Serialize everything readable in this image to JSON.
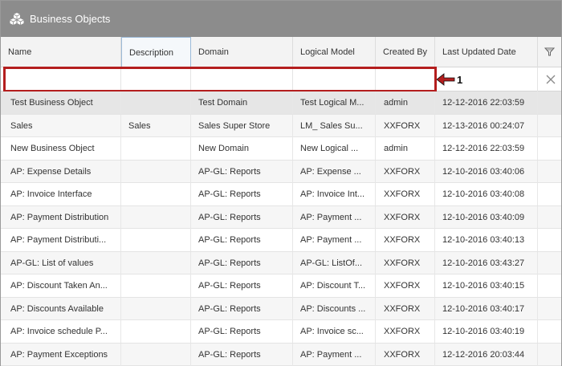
{
  "window": {
    "title": "Business Objects",
    "logo_icon": "business-objects-cubes-icon"
  },
  "table": {
    "columns": [
      {
        "key": "name",
        "label": "Name"
      },
      {
        "key": "description",
        "label": "Description"
      },
      {
        "key": "domain",
        "label": "Domain"
      },
      {
        "key": "logical_model",
        "label": "Logical Model"
      },
      {
        "key": "created_by",
        "label": "Created By"
      },
      {
        "key": "last_updated",
        "label": "Last Updated Date"
      }
    ],
    "filter_icon": "filter-icon",
    "filters": {
      "name": "",
      "description": "",
      "domain": "",
      "logical_model": "",
      "created_by": ""
    },
    "clear_icon": "close-icon",
    "rows": [
      {
        "name": "Test Business Object",
        "description": "",
        "domain": "Test Domain",
        "logical_model": "Test Logical M...",
        "created_by": "admin",
        "last_updated": "12-12-2016 22:03:59"
      },
      {
        "name": "Sales",
        "description": "Sales",
        "domain": "Sales Super Store",
        "logical_model": "LM_ Sales Su...",
        "created_by": "XXFORX",
        "last_updated": "12-13-2016 00:24:07"
      },
      {
        "name": "New Business Object",
        "description": "",
        "domain": "New Domain",
        "logical_model": "New Logical ...",
        "created_by": "admin",
        "last_updated": "12-12-2016 22:03:59"
      },
      {
        "name": "AP: Expense Details",
        "description": "",
        "domain": "AP-GL: Reports",
        "logical_model": "AP: Expense ...",
        "created_by": "XXFORX",
        "last_updated": "12-10-2016 03:40:06"
      },
      {
        "name": "AP: Invoice Interface",
        "description": "",
        "domain": "AP-GL: Reports",
        "logical_model": "AP: Invoice Int...",
        "created_by": "XXFORX",
        "last_updated": "12-10-2016 03:40:08"
      },
      {
        "name": "AP: Payment Distribution",
        "description": "",
        "domain": "AP-GL: Reports",
        "logical_model": "AP: Payment ...",
        "created_by": "XXFORX",
        "last_updated": "12-10-2016 03:40:09"
      },
      {
        "name": "AP: Payment Distributi...",
        "description": "",
        "domain": "AP-GL: Reports",
        "logical_model": "AP: Payment ...",
        "created_by": "XXFORX",
        "last_updated": "12-10-2016 03:40:13"
      },
      {
        "name": "AP-GL: List of values",
        "description": "",
        "domain": "AP-GL: Reports",
        "logical_model": "AP-GL: ListOf...",
        "created_by": "XXFORX",
        "last_updated": "12-10-2016 03:43:27"
      },
      {
        "name": "AP: Discount Taken An...",
        "description": "",
        "domain": "AP-GL: Reports",
        "logical_model": "AP: Discount T...",
        "created_by": "XXFORX",
        "last_updated": "12-10-2016 03:40:15"
      },
      {
        "name": "AP: Discounts Available",
        "description": "",
        "domain": "AP-GL: Reports",
        "logical_model": "AP: Discounts ...",
        "created_by": "XXFORX",
        "last_updated": "12-10-2016 03:40:17"
      },
      {
        "name": "AP: Invoice schedule P...",
        "description": "",
        "domain": "AP-GL: Reports",
        "logical_model": "AP: Invoice sc...",
        "created_by": "XXFORX",
        "last_updated": "12-10-2016 03:40:19"
      },
      {
        "name": "AP: Payment Exceptions",
        "description": "",
        "domain": "AP-GL: Reports",
        "logical_model": "AP: Payment ...",
        "created_by": "XXFORX",
        "last_updated": "12-12-2016 20:03:44"
      }
    ]
  },
  "annotation": {
    "callout_number": "1",
    "highlight_color": "#b41e1e"
  }
}
